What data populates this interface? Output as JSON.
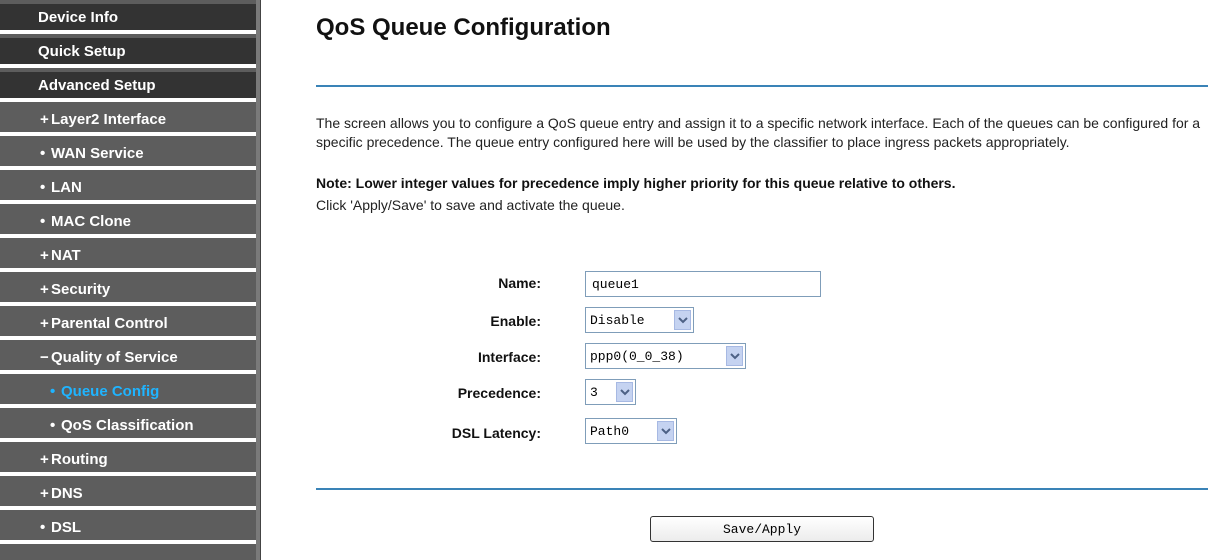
{
  "sidebar": {
    "items": [
      {
        "label": "Device Info",
        "bullet": ""
      },
      {
        "label": "Quick Setup",
        "bullet": ""
      },
      {
        "label": "Advanced Setup",
        "bullet": ""
      },
      {
        "label": "Layer2 Interface",
        "bullet": "+"
      },
      {
        "label": "WAN Service",
        "bullet": "•"
      },
      {
        "label": "LAN",
        "bullet": "•"
      },
      {
        "label": "MAC Clone",
        "bullet": "•"
      },
      {
        "label": "NAT",
        "bullet": "+"
      },
      {
        "label": "Security",
        "bullet": "+"
      },
      {
        "label": "Parental Control",
        "bullet": "+"
      },
      {
        "label": "Quality of Service",
        "bullet": "−"
      },
      {
        "label": "Queue Config",
        "bullet": "•"
      },
      {
        "label": "QoS Classification",
        "bullet": "•"
      },
      {
        "label": "Routing",
        "bullet": "+"
      },
      {
        "label": "DNS",
        "bullet": "+"
      },
      {
        "label": "DSL",
        "bullet": "•"
      }
    ]
  },
  "page": {
    "title": "QoS Queue Configuration",
    "description": "The screen allows you to configure a QoS queue entry and assign it to a specific network interface. Each of the queues can be configured for a specific precedence. The queue entry configured here will be used by the classifier to place ingress packets appropriately.",
    "note": "Note: Lower integer values for precedence imply higher priority for this queue relative to others.",
    "instruction": "Click 'Apply/Save' to save and activate the queue."
  },
  "form": {
    "name_label": "Name:",
    "name_value": "queue1",
    "enable_label": "Enable:",
    "enable_value": "Disable",
    "interface_label": "Interface:",
    "interface_value": "ppp0(0_0_38)",
    "precedence_label": "Precedence:",
    "precedence_value": "3",
    "latency_label": "DSL Latency:",
    "latency_value": "Path0",
    "save_label": "Save/Apply"
  },
  "colors": {
    "sidebar_top": "#333333",
    "sidebar_sub": "#5d5d5d",
    "active_item": "#1fb4ff",
    "rule": "#3a83b7"
  }
}
